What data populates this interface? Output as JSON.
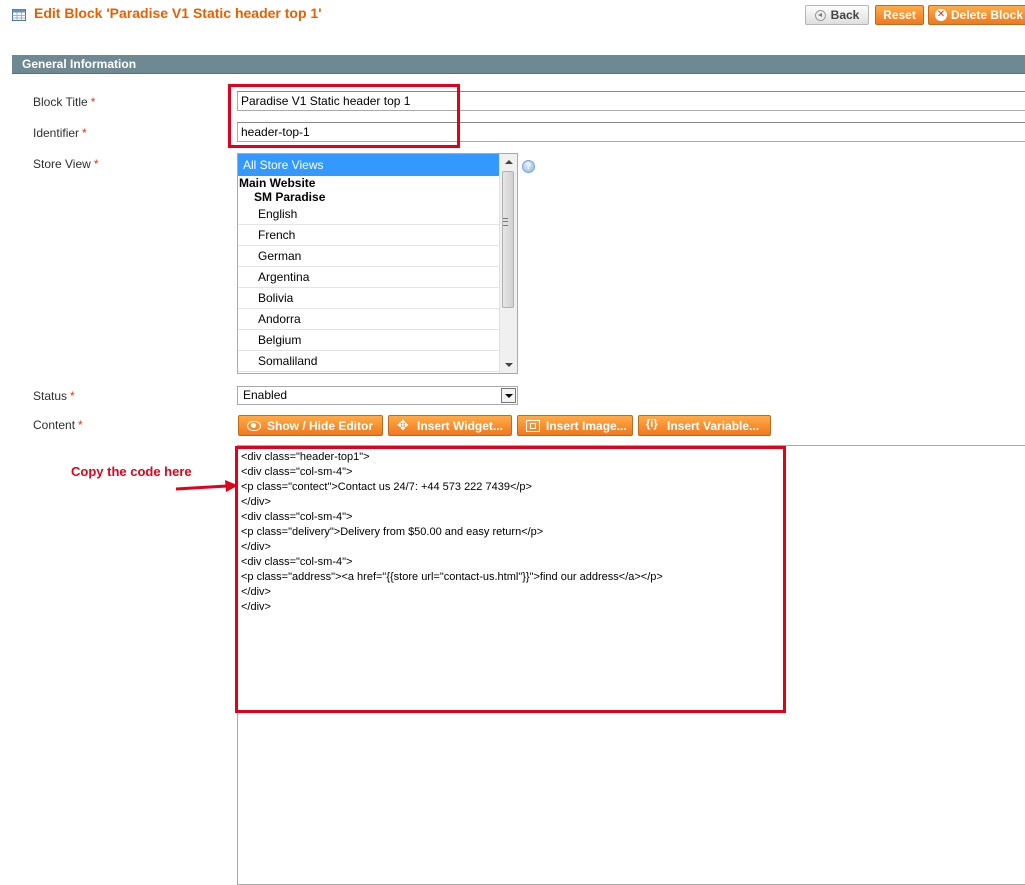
{
  "header": {
    "title": "Edit Block 'Paradise V1 Static header top 1'",
    "back_label": "Back",
    "reset_label": "Reset",
    "delete_label": "Delete Block"
  },
  "section": {
    "title": "General Information"
  },
  "form": {
    "block_title": {
      "label": "Block Title",
      "required": "*",
      "value": "Paradise V1 Static header top 1"
    },
    "identifier": {
      "label": "Identifier",
      "required": "*",
      "value": "header-top-1"
    },
    "store_view": {
      "label": "Store View",
      "required": "*",
      "selected": "All Store Views",
      "group_website": "Main Website",
      "group_store": "SM Paradise",
      "options": [
        "English",
        "French",
        "German",
        "Argentina",
        "Bolivia",
        "Andorra",
        "Belgium",
        "Somaliland"
      ]
    },
    "status": {
      "label": "Status",
      "required": "*",
      "value": "Enabled"
    },
    "content": {
      "label": "Content",
      "required": "*"
    }
  },
  "editor_buttons": {
    "show_hide": "Show / Hide Editor",
    "insert_widget": "Insert Widget...",
    "insert_image": "Insert Image...",
    "insert_variable": "Insert Variable..."
  },
  "content_code": "<div class=\"header-top1\">\n<div class=\"col-sm-4\">\n<p class=\"contect\">Contact us 24/7: +44 573 222 7439</p>\n</div>\n<div class=\"col-sm-4\">\n<p class=\"delivery\">Delivery from $50.00 and easy return</p>\n</div>\n<div class=\"col-sm-4\">\n<p class=\"address\"><a href=\"{{store url=\"contact-us.html\"}}\">find our address</a></p>\n</div>\n</div>",
  "annotation": {
    "text": "Copy the code here",
    "color": "#e3001b"
  },
  "colors": {
    "accent": "#eb5e00",
    "section_bar": "#6f8992",
    "selected": "#3399ff"
  }
}
